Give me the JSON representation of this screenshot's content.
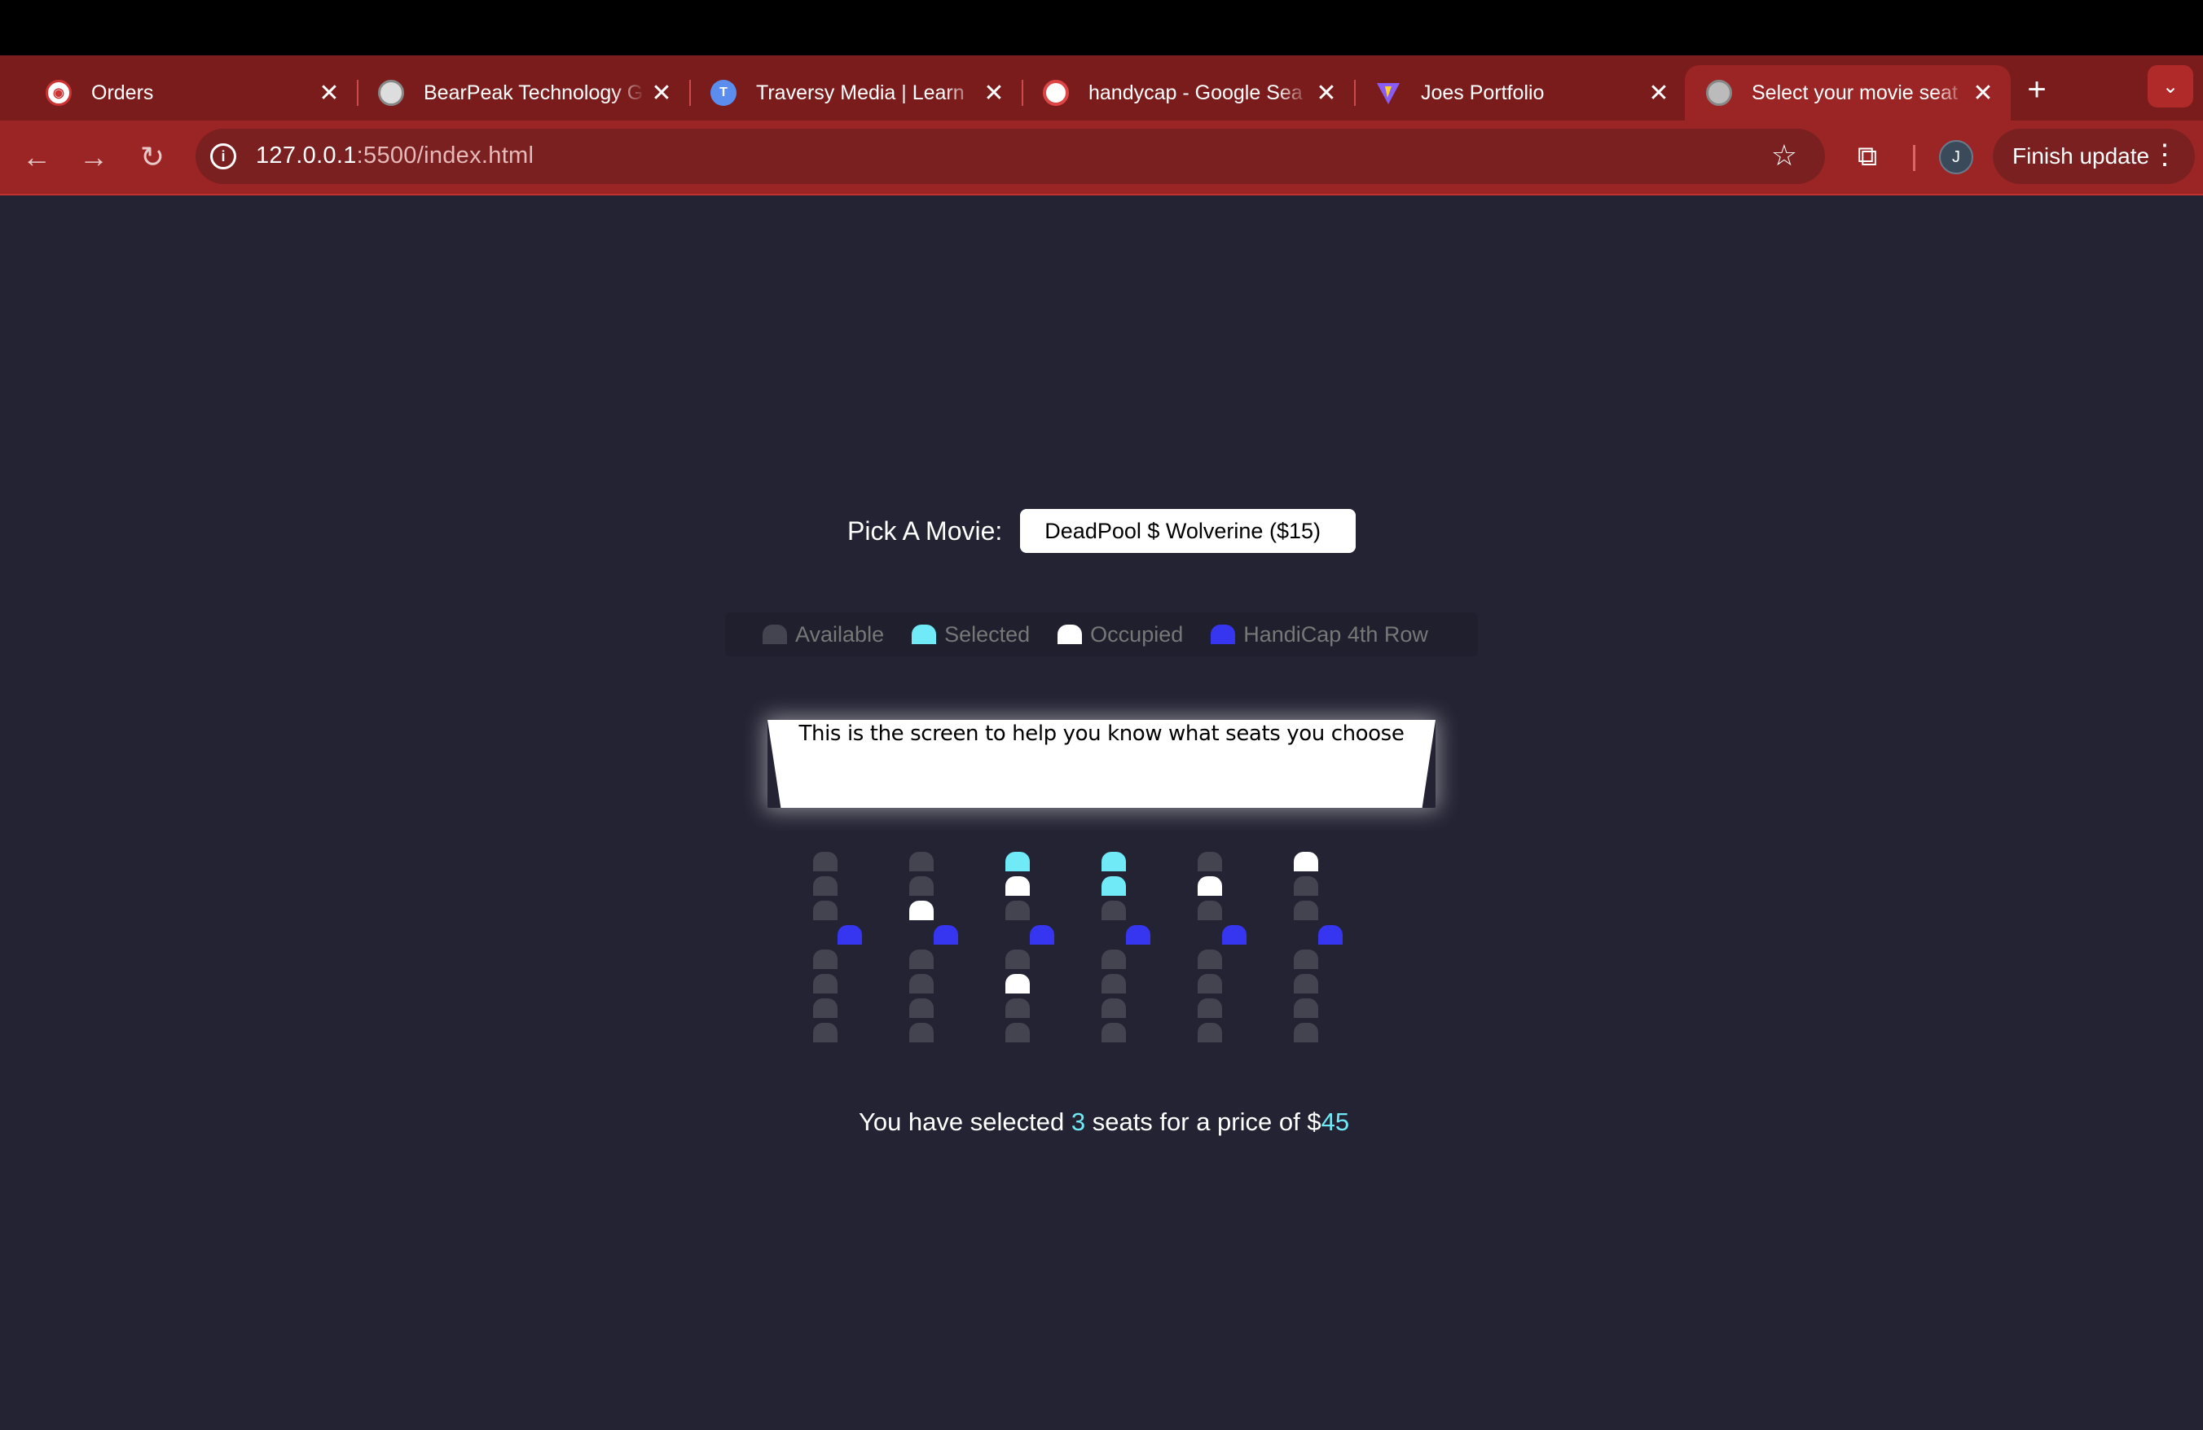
{
  "browser": {
    "tabs": [
      {
        "title": "Orders",
        "favicon": "orders-icon",
        "active": false
      },
      {
        "title": "BearPeak Technology G",
        "favicon": "bearpeak-icon",
        "active": false
      },
      {
        "title": "Traversy Media | Learn",
        "favicon": "traversy-icon",
        "active": false
      },
      {
        "title": "handycap - Google Sea",
        "favicon": "google-icon",
        "active": false
      },
      {
        "title": "Joes Portfolio",
        "favicon": "vite-icon",
        "active": false
      },
      {
        "title": "Select your movie seat",
        "favicon": "globe-icon",
        "active": true
      }
    ],
    "url_host": "127.0.0.1",
    "url_path": ":5500/index.html",
    "profile_initial": "J",
    "finish_update_label": "Finish update"
  },
  "page": {
    "movie_label": "Pick A Movie:",
    "movie_selected": "DeadPool $ Wolverine ($15)",
    "legend": [
      {
        "label": "Available",
        "status": "available"
      },
      {
        "label": "Selected",
        "status": "selected"
      },
      {
        "label": "Occupied",
        "status": "occupied"
      },
      {
        "label": "HandiCap 4th Row",
        "status": "handicap"
      }
    ],
    "screen_text": "This is the screen to help you know what seats you choose",
    "seat_columns": [
      [
        "available",
        "available",
        "available",
        "handicap",
        "available",
        "available",
        "available",
        "available"
      ],
      [
        "available",
        "available",
        "occupied",
        "handicap",
        "available",
        "available",
        "available",
        "available"
      ],
      [
        "selected",
        "occupied",
        "available",
        "handicap",
        "available",
        "occupied",
        "available",
        "available"
      ],
      [
        "selected",
        "selected",
        "available",
        "handicap",
        "available",
        "available",
        "available",
        "available"
      ],
      [
        "available",
        "occupied",
        "available",
        "handicap",
        "available",
        "available",
        "available",
        "available"
      ],
      [
        "occupied",
        "available",
        "available",
        "handicap",
        "available",
        "available",
        "available",
        "available"
      ]
    ],
    "summary": {
      "prefix": "You have selected ",
      "count": "3",
      "middle": " seats for a price of $",
      "total": "45"
    }
  },
  "colors": {
    "available": "#444451",
    "selected": "#6feaf6",
    "occupied": "#ffffff",
    "handicap": "#3636f0",
    "page_bg": "#242333",
    "chrome_tab_strip": "#7b1c1c",
    "chrome_toolbar": "#9b2424"
  }
}
